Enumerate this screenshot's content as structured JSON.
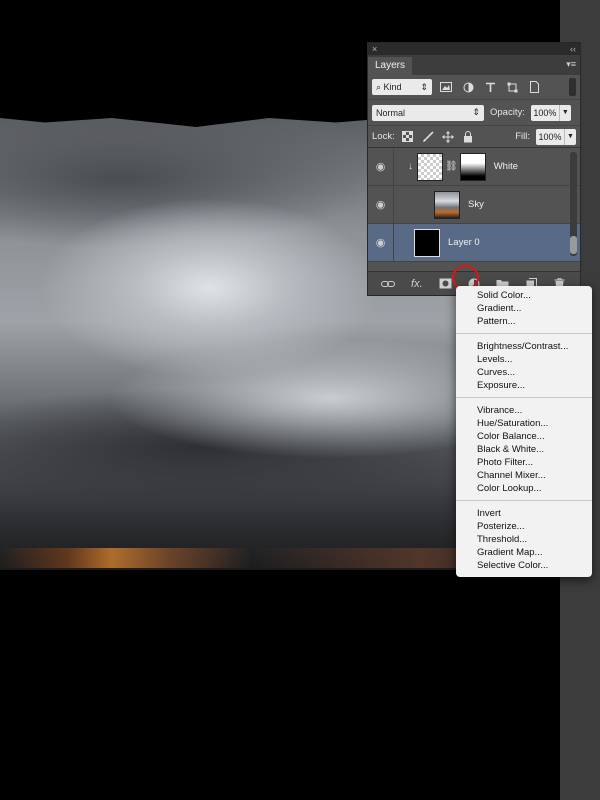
{
  "panel": {
    "close_glyph": "×",
    "collapse_glyph": "‹‹",
    "tab_label": "Layers",
    "tab_menu_glyph": "▾≡",
    "filter": {
      "kind_label": "⌕ Kind",
      "kind_arrow": "⇕"
    },
    "blend": {
      "mode": "Normal",
      "mode_arrow": "⇕",
      "opacity_label": "Opacity:",
      "opacity_value": "100%",
      "fill_label": "Fill:",
      "fill_value": "100%",
      "lock_label": "Lock:"
    },
    "layers": [
      {
        "name": "White"
      },
      {
        "name": "Sky"
      },
      {
        "name": "Layer 0"
      }
    ],
    "footer_icons": [
      "link-icon",
      "fx-icon",
      "mask-icon",
      "adjustment-icon",
      "group-icon",
      "new-layer-icon",
      "trash-icon"
    ],
    "fx_label": "fx."
  },
  "adjustment_menu": {
    "groups": [
      [
        "Solid Color...",
        "Gradient...",
        "Pattern..."
      ],
      [
        "Brightness/Contrast...",
        "Levels...",
        "Curves...",
        "Exposure..."
      ],
      [
        "Vibrance...",
        "Hue/Saturation...",
        "Color Balance...",
        "Black & White...",
        "Photo Filter...",
        "Channel Mixer...",
        "Color Lookup..."
      ],
      [
        "Invert",
        "Posterize...",
        "Threshold...",
        "Gradient Map...",
        "Selective Color..."
      ]
    ]
  },
  "colors": {
    "panel_bg": "#535353",
    "selected_layer": "#586a86",
    "highlight_circle": "#e01414",
    "menu_bg": "#f2f2f2"
  }
}
